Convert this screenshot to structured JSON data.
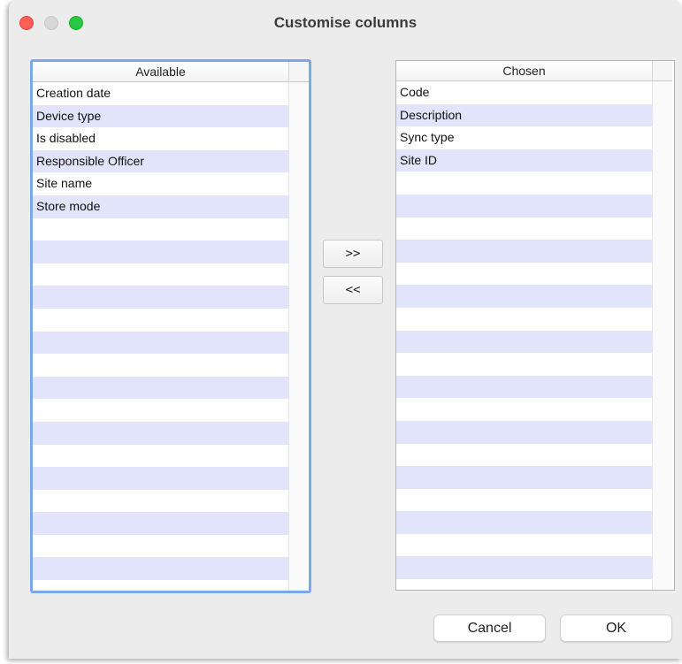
{
  "window": {
    "title": "Customise columns"
  },
  "available": {
    "header": "Available",
    "items": [
      "Creation date",
      "Device type",
      "Is disabled",
      "Responsible Officer",
      "Site name",
      "Store mode",
      "",
      "",
      "",
      "",
      "",
      "",
      "",
      "",
      "",
      "",
      "",
      "",
      "",
      "",
      "",
      ""
    ]
  },
  "chosen": {
    "header": "Chosen",
    "items": [
      "Code",
      "Description",
      "Sync type",
      "Site ID",
      "",
      "",
      "",
      "",
      "",
      "",
      "",
      "",
      "",
      "",
      "",
      "",
      "",
      "",
      "",
      "",
      "",
      ""
    ]
  },
  "buttons": {
    "add_label": ">>",
    "remove_label": "<<",
    "cancel_label": "Cancel",
    "ok_label": "OK"
  },
  "colors": {
    "row_stripe": "#e1e4fb",
    "focus_ring": "#7aa8ea",
    "close": "#fe5f57",
    "minimize": "#d7d7d7",
    "maximize": "#28c840"
  }
}
